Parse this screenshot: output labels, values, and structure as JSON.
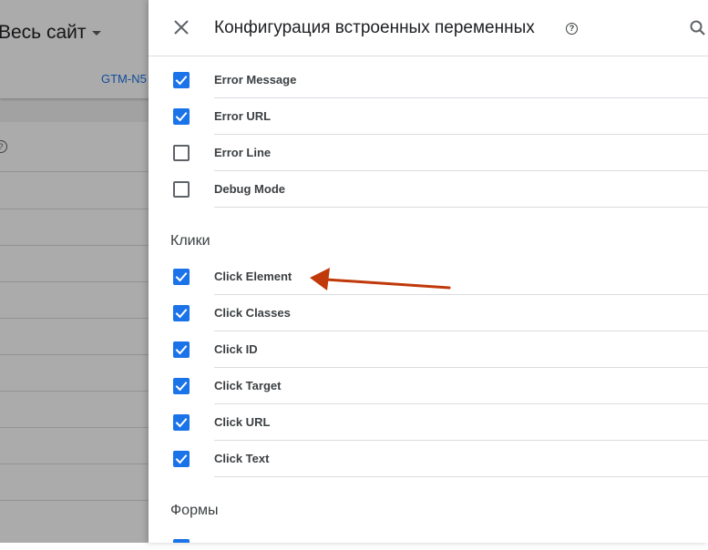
{
  "background": {
    "title": "Весь сайт",
    "container_tab": "GTM-N5"
  },
  "panel": {
    "title": "Конфигурация встроенных переменных",
    "error_items": [
      {
        "label": "Error Message",
        "checked": true
      },
      {
        "label": "Error URL",
        "checked": true
      },
      {
        "label": "Error Line",
        "checked": false
      },
      {
        "label": "Debug Mode",
        "checked": false
      }
    ],
    "clicks_section": "Клики",
    "click_items": [
      {
        "label": "Click Element",
        "checked": true
      },
      {
        "label": "Click Classes",
        "checked": true
      },
      {
        "label": "Click ID",
        "checked": true
      },
      {
        "label": "Click Target",
        "checked": true
      },
      {
        "label": "Click URL",
        "checked": true
      },
      {
        "label": "Click Text",
        "checked": true
      }
    ],
    "forms_section": "Формы"
  },
  "icons": {
    "close": "close-icon",
    "help": "help-circle-icon",
    "search": "search-icon",
    "checkbox": "checkbox-icon",
    "annotation": "red-arrow"
  },
  "colors": {
    "accent": "#1a73e8",
    "annotation_arrow": "#c0390b"
  }
}
